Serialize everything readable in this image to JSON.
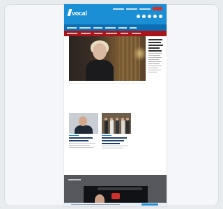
{
  "site": {
    "logo_text": "vocal",
    "brand_color": "#1a8fd6",
    "accent_color": "#a8161b"
  },
  "social_icons": [
    "facebook-icon",
    "twitter-icon",
    "instagram-icon",
    "youtube-icon",
    "rss-icon"
  ],
  "nav_icons": [
    "nav-item",
    "nav-item",
    "nav-item",
    "nav-item",
    "nav-item",
    "nav-item"
  ]
}
